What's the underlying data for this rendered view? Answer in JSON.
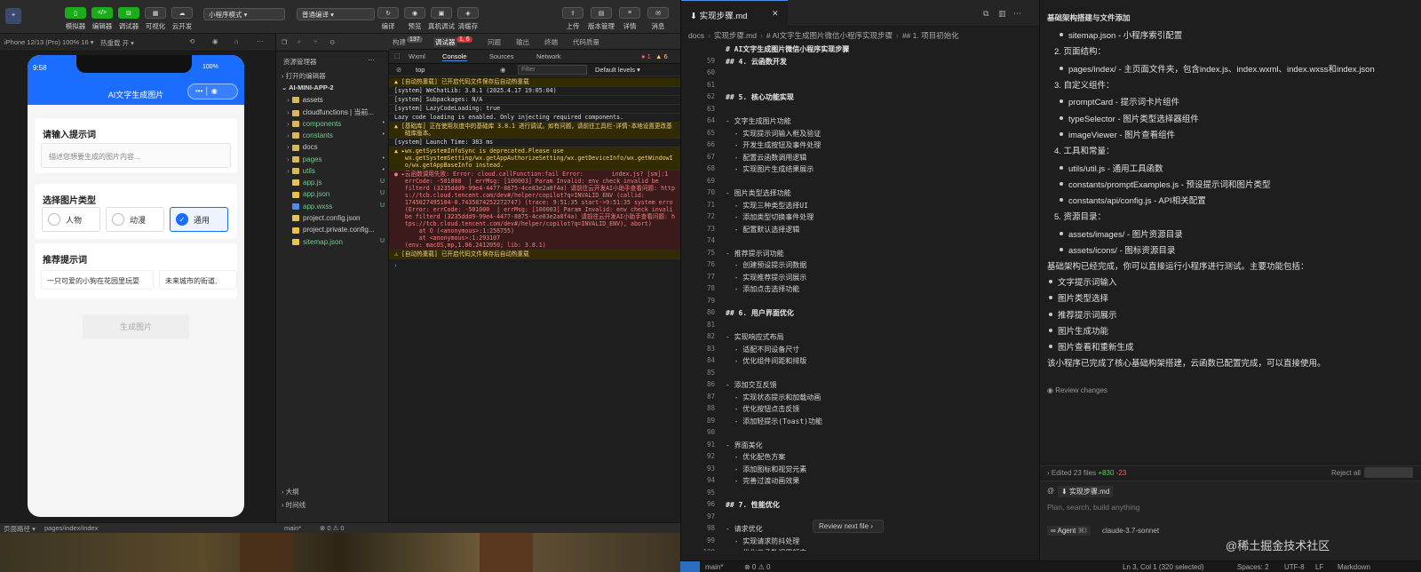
{
  "devtools": {
    "toolbar": [
      {
        "label": "模拟器",
        "icon": "phone-icon"
      },
      {
        "label": "编辑器",
        "icon": "code-icon"
      },
      {
        "label": "调试器",
        "icon": "debug-icon"
      },
      {
        "label": "可视化",
        "icon": "grid-icon"
      },
      {
        "label": "云开发",
        "icon": "cloud-icon"
      }
    ],
    "mode": "小程序模式",
    "compile": "普通编译",
    "center_tools": [
      "编译",
      "预览",
      "真机调试",
      "清缓存"
    ],
    "right_tools": [
      "上传",
      "版本管理",
      "详情",
      "消息"
    ],
    "device": "iPhone 12/13 (Pro) 100% 16 ▾",
    "hotreload": "热重载 开 ▾"
  },
  "phone": {
    "time": "9:58",
    "battery": "100%",
    "title": "AI文字生成图片",
    "prompt_title": "请输入提示词",
    "prompt_placeholder": "描述您想要生成的图片内容...",
    "type_title": "选择图片类型",
    "types": [
      "人物",
      "动漫",
      "通用"
    ],
    "rec_title": "推荐提示词",
    "rec": [
      "一只可爱的小狗在花园里玩耍",
      "未来城市的街道,"
    ],
    "gen": "生成图片"
  },
  "explorer": {
    "title": "资源管理器",
    "open": "打开的编辑器",
    "project": "AI-MINI-APP-2",
    "items": [
      {
        "name": "assets",
        "color": "#d9b85a",
        "status": ""
      },
      {
        "name": "cloudfunctions | 当前...",
        "color": "#d9b85a",
        "status": ""
      },
      {
        "name": "components",
        "color": "#d9b85a",
        "status": "•",
        "hl": "#74c98a"
      },
      {
        "name": "constants",
        "color": "#d9b85a",
        "status": "•",
        "hl": "#74c98a"
      },
      {
        "name": "docs",
        "color": "#d9b85a",
        "status": ""
      },
      {
        "name": "pages",
        "color": "#d9b85a",
        "status": "•",
        "hl": "#74c98a"
      },
      {
        "name": "utils",
        "color": "#d9b85a",
        "status": "•",
        "hl": "#74c98a"
      },
      {
        "name": "app.js",
        "color": "#e8c34a",
        "status": "U",
        "hl": "#74c98a"
      },
      {
        "name": "app.json",
        "color": "#e8c34a",
        "status": "U",
        "hl": "#74c98a"
      },
      {
        "name": "app.wxss",
        "color": "#4a8ee8",
        "status": "U",
        "hl": "#74c98a"
      },
      {
        "name": "project.config.json",
        "color": "#e8c34a",
        "status": ""
      },
      {
        "name": "project.private.config...",
        "color": "#e8c34a",
        "status": ""
      },
      {
        "name": "sitemap.json",
        "color": "#e8c34a",
        "status": "U",
        "hl": "#74c98a"
      }
    ],
    "outline": "大纲",
    "timeline": "时间线"
  },
  "console": {
    "tabs": [
      "构建",
      "调试器",
      "问题",
      "输出",
      "终端",
      "代码质量"
    ],
    "build_count": "137",
    "debug_count": "1, 6",
    "subtabs": [
      "Wxml",
      "Console",
      "Sources",
      "Network"
    ],
    "top": "top",
    "filter": "Filter",
    "levels": "Default levels ▾",
    "errors": "1",
    "warnings": "6",
    "lines": [
      {
        "k": "warn",
        "t": "▲ [自动热重载] 已开启代码文件保存后自动热重载"
      },
      {
        "k": "",
        "t": "[system] WeChatLib: 3.8.1 (2025.4.17 19:05:04)"
      },
      {
        "k": "",
        "t": "[system] Subpackages: N/A"
      },
      {
        "k": "",
        "t": "[system] LazyCodeLoading: true"
      },
      {
        "k": "",
        "t": "Lazy code loading is enabled. Only injecting required components."
      },
      {
        "k": "warn",
        "t": "▲ [基础库] 正在使用灰度中的基础库 3.8.1 进行调试。如有问题，请前往工具栏-详情-本地设置更改基\n   础库版本。"
      },
      {
        "k": "",
        "t": "[system] Launch Time: 383 ms"
      },
      {
        "k": "warn",
        "t": "▲ ▸wx.getSystemInfoSync is deprecated.Please use\n   wx.getSystemSetting/wx.getAppAuthorizeSetting/wx.getDeviceInfo/wx.getWindowI\n   o/wx.getAppBaseInfo instead."
      },
      {
        "k": "err",
        "t": "● ▸云函数调用失败: Error: cloud.callFunction:fail Error:        index.js? [sm]:1\n   errCode: -501000  | errMsg: [100003] Param Invalid: env check invalid be\n   filterd (3235ddd9-99e4-4477-8875-4ce83e2a8f4a) 请前往云开发AI小助手查看问题: http\n   s://tcb.cloud.tencent.com/dev#/helper/copilot?q=INVALID_ENV (callid:\n   1745027495104-0.7435874252272747) (trace: 9:51:35 start->9:51:35 system erro\n   (Error: errCode: -501000  | errMsg: [100003] Param Invalid: env check invali\n   be filterd (3235ddd9-99e4-4477-8875-4ce83e2a8f4a) 请前往云开发AI小助手查看问题: h\n   tps://tcb.cloud.tencent.com/dev#/helper/copilot?q=INVALID_ENV), abort)\n       at O (<anonymous>:1:256755)\n       at <anonymous>:1:293107\n   (env: macOS,mp,1.06.2412050; lib: 3.8.1)"
      },
      {
        "k": "warn",
        "t": "⚠ [自动热重载] 已开启代码文件保存后自动热重载"
      }
    ]
  },
  "status_left": {
    "path": "页面路径 ▾",
    "page": "pages/index/index",
    "branch": "main*",
    "counts": "⊗ 0 ⚠ 0"
  },
  "editor": {
    "tab": "实现步骤.md",
    "breadcrumb": [
      "docs",
      "实现步骤.md",
      "# AI文字生成图片微信小程序实现步骤",
      "## 1. 项目初始化"
    ],
    "lines": [
      [
        "",
        "# AI文字生成图片微信小程序实现步骤"
      ],
      [
        "59",
        "## 4. 云函数开发"
      ],
      [
        "60",
        ""
      ],
      [
        "61",
        ""
      ],
      [
        "62",
        "## 5. 核心功能实现"
      ],
      [
        "63",
        ""
      ],
      [
        "64",
        "- 文字生成图片功能"
      ],
      [
        "65",
        "  - 实现提示词输入框及验证"
      ],
      [
        "66",
        "  - 开发生成按钮及事件处理"
      ],
      [
        "67",
        "  - 配置云函数调用逻辑"
      ],
      [
        "68",
        "  - 实现图片生成结果展示"
      ],
      [
        "69",
        ""
      ],
      [
        "70",
        "- 图片类型选择功能"
      ],
      [
        "71",
        "  - 实现三种类型选择UI"
      ],
      [
        "72",
        "  - 添加类型切换事件处理"
      ],
      [
        "73",
        "  - 配置默认选择逻辑"
      ],
      [
        "74",
        ""
      ],
      [
        "75",
        "- 推荐提示词功能"
      ],
      [
        "76",
        "  - 创建预设提示词数据"
      ],
      [
        "77",
        "  - 实现推荐提示词展示"
      ],
      [
        "78",
        "  - 添加点击选择功能"
      ],
      [
        "79",
        ""
      ],
      [
        "80",
        "## 6. 用户界面优化"
      ],
      [
        "81",
        ""
      ],
      [
        "82",
        "- 实现响应式布局"
      ],
      [
        "83",
        "  - 适配不同设备尺寸"
      ],
      [
        "84",
        "  - 优化组件间距和排版"
      ],
      [
        "85",
        ""
      ],
      [
        "86",
        "- 添加交互反馈"
      ],
      [
        "87",
        "  - 实现状态提示和加载动画"
      ],
      [
        "88",
        "  - 优化按钮点击反馈"
      ],
      [
        "89",
        "  - 添加轻提示(Toast)功能"
      ],
      [
        "90",
        ""
      ],
      [
        "91",
        "- 界面美化"
      ],
      [
        "92",
        "  - 优化配色方案"
      ],
      [
        "93",
        "  - 添加图标和视觉元素"
      ],
      [
        "94",
        "  - 完善过渡动画效果"
      ],
      [
        "95",
        ""
      ],
      [
        "96",
        "## 7. 性能优化"
      ],
      [
        "97",
        ""
      ],
      [
        "98",
        "- 请求优化"
      ],
      [
        "99",
        "  - 实现请求防抖处理"
      ],
      [
        "100",
        "  - 优化云函数调用频率"
      ],
      [
        "101",
        ""
      ]
    ],
    "review": "Review next file"
  },
  "chat": {
    "header": "基础架构搭建与文件添加",
    "blocks": [
      {
        "t": "sub",
        "x": "sitemap.json - 小程序索引配置"
      },
      {
        "t": "num",
        "x": "2. 页面结构："
      },
      {
        "t": "sub",
        "x": "pages/index/ - 主页面文件夹，包含index.js、index.wxml、index.wxss和index.json"
      },
      {
        "t": "num",
        "x": "3. 自定义组件："
      },
      {
        "t": "sub",
        "x": "promptCard - 提示词卡片组件"
      },
      {
        "t": "sub",
        "x": "typeSelector - 图片类型选择器组件"
      },
      {
        "t": "sub",
        "x": "imageViewer - 图片查看组件"
      },
      {
        "t": "num",
        "x": "4. 工具和常量："
      },
      {
        "t": "sub",
        "x": "utils/util.js - 通用工具函数"
      },
      {
        "t": "sub",
        "x": "constants/promptExamples.js - 预设提示词和图片类型"
      },
      {
        "t": "sub",
        "x": "constants/api/config.js - API相关配置"
      },
      {
        "t": "num",
        "x": "5. 资源目录："
      },
      {
        "t": "sub",
        "x": "assets/images/ - 图片资源目录"
      },
      {
        "t": "sub",
        "x": "assets/icons/ - 图标资源目录"
      },
      {
        "t": "p",
        "x": "基础架构已经完成，你可以直接运行小程序进行测试。主要功能包括："
      },
      {
        "t": "bul",
        "x": "文字提示词输入"
      },
      {
        "t": "bul",
        "x": "图片类型选择"
      },
      {
        "t": "bul",
        "x": "推荐提示词展示"
      },
      {
        "t": "bul",
        "x": "图片生成功能"
      },
      {
        "t": "bul",
        "x": "图片查看和重新生成"
      },
      {
        "t": "p",
        "x": "该小程序已完成了核心基础构架搭建，云函数已配置完成，可以直接使用。"
      }
    ],
    "review_changes": "Review changes",
    "edited": "Edited 23 files",
    "plus": "+830",
    "minus": "-23",
    "reject": "Reject all",
    "ctx_file": "实现步骤.md",
    "placeholder": "Plan, search, build anything",
    "agent": "Agent",
    "shortcut": "⌘I",
    "model": "claude-3.7-sonnet"
  },
  "status_right": {
    "branch": "main*",
    "counts": "⊗ 0 ⚠ 0",
    "pos": "Ln 3, Col 1 (320 selected)",
    "spaces": "Spaces: 2",
    "enc": "UTF-8",
    "eol": "LF",
    "lang": "Markdown"
  },
  "watermark": "@稀土掘金技术社区"
}
